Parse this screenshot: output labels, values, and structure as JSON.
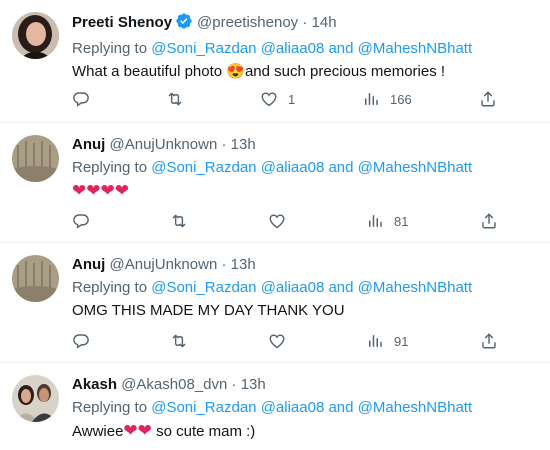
{
  "tweets": [
    {
      "name": "Preeti Shenoy",
      "verified": true,
      "handle": "@preetishenoy",
      "separator": "·",
      "time": "14h",
      "replying_prefix": "Replying to",
      "mentions": [
        "@Soni_Razdan",
        "@aliaa08"
      ],
      "and_word": "and",
      "last_mention": "@MaheshNBhatt",
      "text_before": "What a beautiful photo ",
      "emoji": "😍",
      "text_after": "and such precious memories !",
      "reply_count": "",
      "retweet_count": "",
      "like_count": "1",
      "view_count": "166"
    },
    {
      "name": "Anuj",
      "handle": "@AnujUnknown",
      "separator": "·",
      "time": "13h",
      "replying_prefix": "Replying to",
      "mentions": [
        "@Soni_Razdan",
        "@aliaa08"
      ],
      "and_word": "and",
      "last_mention": "@MaheshNBhatt",
      "hearts": "❤❤❤❤",
      "reply_count": "",
      "retweet_count": "",
      "like_count": "",
      "view_count": "81"
    },
    {
      "name": "Anuj",
      "handle": "@AnujUnknown",
      "separator": "·",
      "time": "13h",
      "replying_prefix": "Replying to",
      "mentions": [
        "@Soni_Razdan",
        "@aliaa08"
      ],
      "and_word": "and",
      "last_mention": "@MaheshNBhatt",
      "text": "OMG THIS MADE MY DAY THANK YOU",
      "reply_count": "",
      "retweet_count": "",
      "like_count": "",
      "view_count": "91"
    },
    {
      "name": "Akash",
      "handle": "@Akash08_dvn",
      "separator": "·",
      "time": "13h",
      "replying_prefix": "Replying to",
      "mentions": [
        "@Soni_Razdan",
        "@aliaa08"
      ],
      "and_word": "and",
      "last_mention": "@MaheshNBhatt",
      "text_before": "Awwiee",
      "hearts": "❤❤",
      "text_after": " so cute mam :)"
    }
  ],
  "colors": {
    "link": "#1d9bf0",
    "secondary_text": "#536471",
    "primary_text": "#0f1419",
    "verified_badge": "#1d9bf0",
    "heart": "#e0245e"
  },
  "icons": [
    "reply-icon",
    "retweet-icon",
    "like-icon",
    "views-icon",
    "share-icon",
    "verified-badge-icon"
  ]
}
